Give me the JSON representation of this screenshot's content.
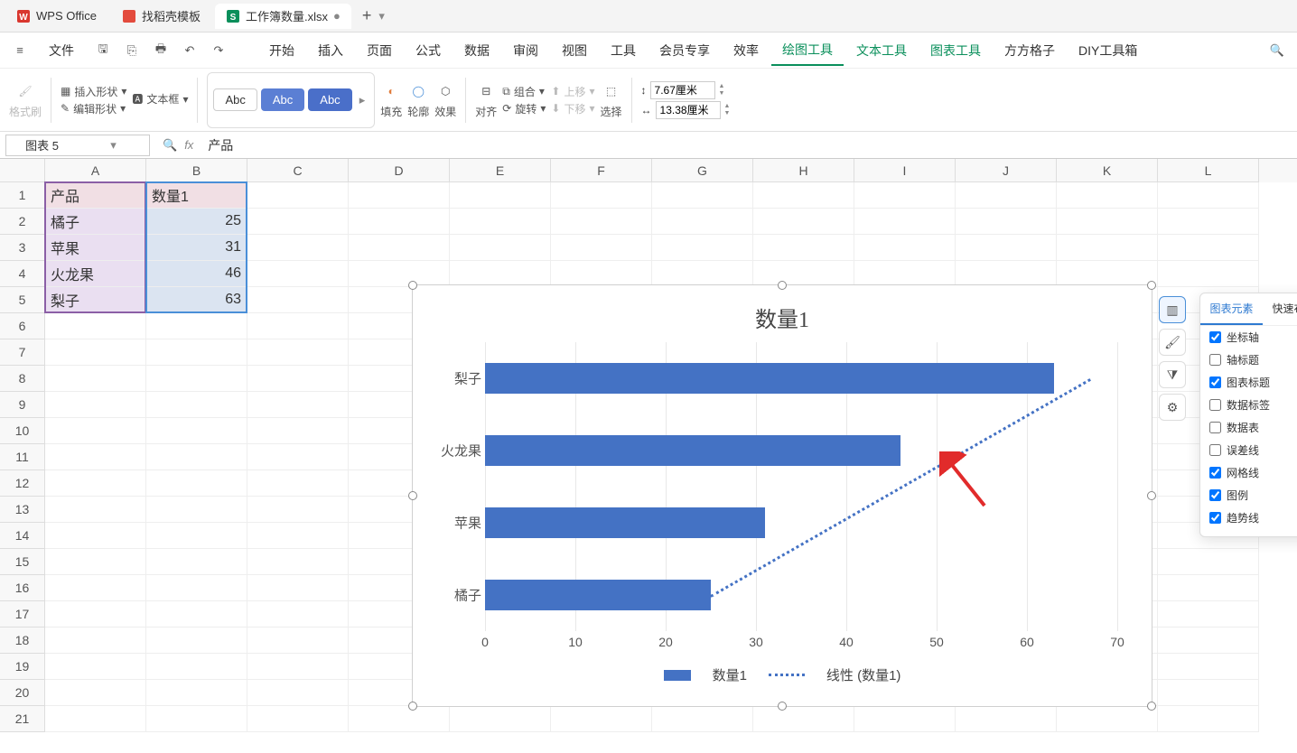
{
  "titlebar": {
    "app": "WPS Office",
    "tab_template": "找稻壳模板",
    "tab_workbook": "工作簿数量.xlsx"
  },
  "menubar": {
    "file": "文件",
    "items": [
      "开始",
      "插入",
      "页面",
      "公式",
      "数据",
      "审阅",
      "视图",
      "工具",
      "会员专享",
      "效率",
      "绘图工具",
      "文本工具",
      "图表工具",
      "方方格子",
      "DIY工具箱"
    ]
  },
  "ribbon": {
    "format_painter": "格式刷",
    "insert_shape": "插入形状",
    "textbox": "文本框",
    "edit_shape": "编辑形状",
    "abc1": "Abc",
    "abc2": "Abc",
    "abc3": "Abc",
    "fill": "填充",
    "outline": "轮廓",
    "effect": "效果",
    "align": "对齐",
    "combine": "组合",
    "rotate": "旋转",
    "up": "上移",
    "down": "下移",
    "select": "选择",
    "height": "7.67厘米",
    "width": "13.38厘米"
  },
  "formulabar": {
    "namebox": "图表 5",
    "fx_text": "产品"
  },
  "columns": [
    "A",
    "B",
    "C",
    "D",
    "E",
    "F",
    "G",
    "H",
    "I",
    "J",
    "K",
    "L"
  ],
  "rows": [
    "1",
    "2",
    "3",
    "4",
    "5",
    "6",
    "7",
    "8",
    "9",
    "10",
    "11",
    "12",
    "13",
    "14",
    "15",
    "16",
    "17",
    "18",
    "19",
    "20",
    "21"
  ],
  "data": {
    "headerA": "产品",
    "headerB": "数量1",
    "r2a": "橘子",
    "r2b": "25",
    "r3a": "苹果",
    "r3b": "31",
    "r4a": "火龙果",
    "r4b": "46",
    "r5a": "梨子",
    "r5b": "63"
  },
  "chart_data": {
    "type": "bar",
    "title": "数量1",
    "categories": [
      "梨子",
      "火龙果",
      "苹果",
      "橘子"
    ],
    "values": [
      63,
      46,
      31,
      25
    ],
    "xlabel": "",
    "ylabel": "",
    "xlim": [
      0,
      70
    ],
    "ticks": [
      0,
      10,
      20,
      30,
      40,
      50,
      60,
      70
    ],
    "legend": {
      "series": "数量1",
      "trend": "线性 (数量1)"
    }
  },
  "chart_tools": {
    "elements": "图表元素",
    "quick_layout": "快速布局",
    "items": [
      {
        "label": "坐标轴",
        "checked": true
      },
      {
        "label": "轴标题",
        "checked": false
      },
      {
        "label": "图表标题",
        "checked": true
      },
      {
        "label": "数据标签",
        "checked": false
      },
      {
        "label": "数据表",
        "checked": false
      },
      {
        "label": "误差线",
        "checked": false
      },
      {
        "label": "网格线",
        "checked": true
      },
      {
        "label": "图例",
        "checked": true
      },
      {
        "label": "趋势线",
        "checked": true
      }
    ]
  }
}
